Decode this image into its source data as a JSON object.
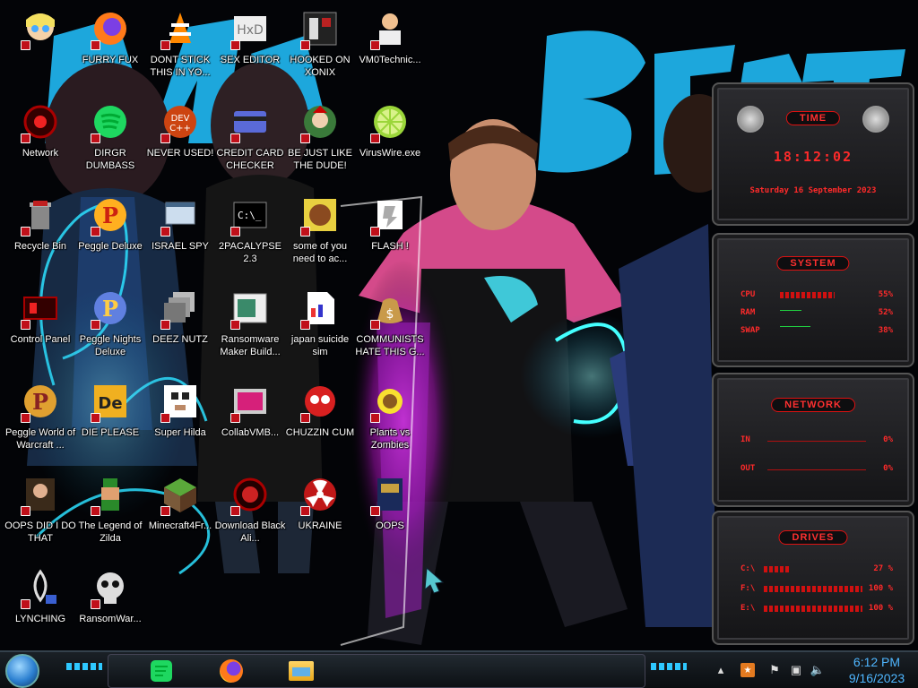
{
  "wallpaper": {
    "text": "MrBeast"
  },
  "desktop_icons": [
    {
      "label": "",
      "icon": "star-butterfly-icon"
    },
    {
      "label": "FURRY FUX",
      "icon": "firefox-icon"
    },
    {
      "label": "DONT STICK THIS IN YO...",
      "icon": "vlc-cone-icon"
    },
    {
      "label": "SEX EDITOR",
      "icon": "hxd-icon"
    },
    {
      "label": "HOOKED ON XONIX",
      "icon": "xonix-icon"
    },
    {
      "label": "VM0Technic...",
      "icon": "doctor-icon"
    },
    {
      "label": "Network",
      "icon": "network-orb-icon"
    },
    {
      "label": "DIRGR DUMBASS",
      "icon": "dirgr-icon"
    },
    {
      "label": "NEVER USED!",
      "icon": "devcpp-icon"
    },
    {
      "label": "CREDIT CARD CHECKER",
      "icon": "credit-card-icon"
    },
    {
      "label": "BE JUST LIKE THE DUDE!",
      "icon": "dude-icon"
    },
    {
      "label": "VirusWire.exe",
      "icon": "lime-icon"
    },
    {
      "label": "Recycle Bin",
      "icon": "recycle-bin-icon"
    },
    {
      "label": "Peggle Deluxe",
      "icon": "peggle-icon"
    },
    {
      "label": "ISRAEL SPY",
      "icon": "spy-window-icon"
    },
    {
      "label": "2PACALYPSE 2.3",
      "icon": "terminal-icon"
    },
    {
      "label": "some of you need to ac...",
      "icon": "beaver-icon"
    },
    {
      "label": "FLASH !",
      "icon": "flash-icon"
    },
    {
      "label": "Control Panel",
      "icon": "control-panel-icon"
    },
    {
      "label": "Peggle Nights Deluxe",
      "icon": "peggle-nights-icon"
    },
    {
      "label": "DEEZ NUTZ",
      "icon": "windows-stack-icon"
    },
    {
      "label": "Ransomware Maker Build...",
      "icon": "ransomware-builder-icon"
    },
    {
      "label": "japan suicide sim",
      "icon": "document-icon"
    },
    {
      "label": "COMMUNISTS HATE THIS G...",
      "icon": "money-bag-icon"
    },
    {
      "label": "Peggle World of Warcraft ...",
      "icon": "peggle-wow-icon"
    },
    {
      "label": "DIE PLEASE",
      "icon": "die-icon"
    },
    {
      "label": "Super Hilda",
      "icon": "pixel-dog-icon"
    },
    {
      "label": "CollabVMB...",
      "icon": "collabvm-icon"
    },
    {
      "label": "CHUZZIN CUM",
      "icon": "chuzzle-icon"
    },
    {
      "label": "Plants vs Zombies",
      "icon": "pvz-icon"
    },
    {
      "label": "OOPS DID I DO THAT",
      "icon": "portrait-icon"
    },
    {
      "label": "The Legend of Zilda",
      "icon": "zelda-sprite-icon"
    },
    {
      "label": "Minecraft4Fr...",
      "icon": "minecraft-icon"
    },
    {
      "label": "Download Black Ali...",
      "icon": "black-alien-icon"
    },
    {
      "label": "UKRAINE",
      "icon": "radiation-icon"
    },
    {
      "label": "OOPS",
      "icon": "oops-book-icon"
    },
    {
      "label": "LYNCHING",
      "icon": "lynching-icon"
    },
    {
      "label": "RansomWar...",
      "icon": "skull-icon"
    }
  ],
  "widgets": {
    "time": {
      "title": "TIME",
      "clock": "18:12:02",
      "date": "Saturday 16 September 2023"
    },
    "system": {
      "title": "SYSTEM",
      "rows": [
        {
          "label": "CPU",
          "value": "55%",
          "fill": 0.55
        },
        {
          "label": "RAM",
          "value": "52%",
          "fill": 0.0
        },
        {
          "label": "SWAP",
          "value": "38%",
          "fill": 0.0
        }
      ]
    },
    "network": {
      "title": "NETWORK",
      "rows": [
        {
          "label": "IN",
          "value": "0%"
        },
        {
          "label": "OUT",
          "value": "0%"
        }
      ]
    },
    "drives": {
      "title": "DRIVES",
      "rows": [
        {
          "label": "C:\\",
          "value": "27 %",
          "fill": 0.27
        },
        {
          "label": "F:\\",
          "value": "100 %",
          "fill": 1.0
        },
        {
          "label": "E:\\",
          "value": "100 %",
          "fill": 1.0
        }
      ]
    }
  },
  "taskbar": {
    "pinned": [
      {
        "name": "spotify-like-app",
        "icon": "green-app-icon"
      },
      {
        "name": "firefox",
        "icon": "firefox-icon"
      },
      {
        "name": "file-explorer",
        "icon": "folder-icon"
      }
    ],
    "tray": [
      "show-hidden-icons",
      "app-tray-icon",
      "flag-icon",
      "network-icon",
      "volume-icon"
    ],
    "clock": {
      "time": "6:12 PM",
      "date": "9/16/2023"
    }
  },
  "colors": {
    "widget_accent": "#ff2a2a",
    "clock_text": "#4fb6ff",
    "label_text": "#ffffff"
  }
}
